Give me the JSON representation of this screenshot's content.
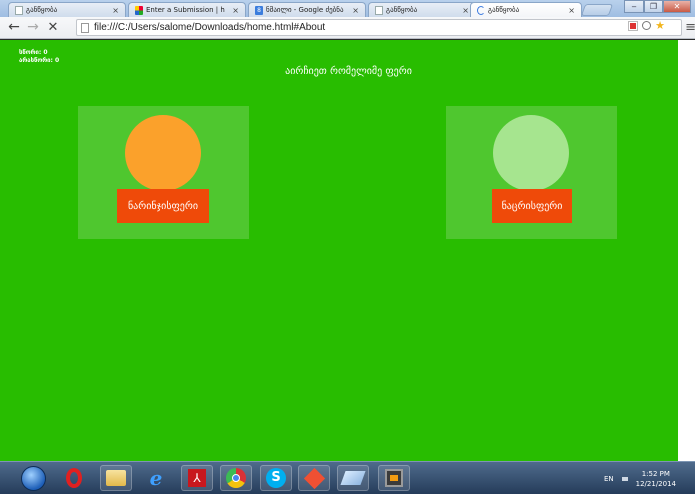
{
  "browser": {
    "tabs": [
      {
        "title": "განწყობა",
        "favicon": "page-icon",
        "active": false
      },
      {
        "title": "Enter a Submission | h",
        "favicon": "submission-icon",
        "active": false
      },
      {
        "title": "ნმაილი - Google ძებნა",
        "favicon": "google-icon",
        "favicon_glyph": "8",
        "active": false
      },
      {
        "title": "განწყობა",
        "favicon": "page-icon",
        "active": false
      },
      {
        "title": "განწყობა",
        "favicon": "loading-icon",
        "active": true
      }
    ],
    "tab_close_glyph": "×",
    "window_controls": {
      "minimize": "‒",
      "maximize": "❐",
      "close": "✕"
    },
    "toolbar": {
      "back_glyph": "←",
      "forward_glyph": "→",
      "stop_glyph": "✕",
      "menu_glyph": "≡"
    },
    "address": {
      "url": "file:///C:/Users/salome/Downloads/home.html#About"
    },
    "omnibox_icons": [
      "translate-icon",
      "zoom-icon",
      "star-icon"
    ]
  },
  "page": {
    "background_color": "#28bd00",
    "scores": {
      "correct_label": "სწორი: 0",
      "wrong_label": "არასწორი: 0"
    },
    "heading": "აირჩიეთ რომელიმე ფერი",
    "cards": [
      {
        "circle_color": "#fba12b",
        "button_label": "ნარინჯისფერი",
        "button_color": "#ef4a09"
      },
      {
        "circle_color": "#a6e58f",
        "button_label": "ნაცრისფერი",
        "button_color": "#ef4a09"
      }
    ]
  },
  "taskbar": {
    "pinned_apps": [
      "opera-icon",
      "explorer-folder-icon",
      "internet-explorer-icon",
      "acrobat-icon",
      "chrome-icon",
      "skype-icon",
      "git-icon",
      "notepad-icon",
      "sublime-icon"
    ],
    "language": "EN",
    "time": "1:52 PM",
    "date": "12/21/2014"
  }
}
